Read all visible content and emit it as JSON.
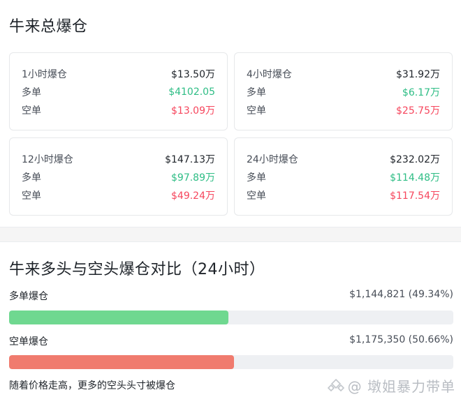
{
  "title": "牛来总爆仓",
  "cards": [
    {
      "period": "1小时爆仓",
      "total": "$13.50万",
      "long_label": "多单",
      "long": "$4102.05",
      "short_label": "空单",
      "short": "$13.09万"
    },
    {
      "period": "4小时爆仓",
      "total": "$31.92万",
      "long_label": "多单",
      "long": "$6.17万",
      "short_label": "空单",
      "short": "$25.75万"
    },
    {
      "period": "12小时爆仓",
      "total": "$147.13万",
      "long_label": "多单",
      "long": "$97.89万",
      "short_label": "空单",
      "short": "$49.24万"
    },
    {
      "period": "24小时爆仓",
      "total": "$232.02万",
      "long_label": "多单",
      "long": "$114.48万",
      "short_label": "空单",
      "short": "$117.54万"
    }
  ],
  "comparison": {
    "title": "牛来多头与空头爆仓对比（24小时）",
    "long": {
      "label": "多单爆仓",
      "value": "$1,144,821 (49.34%)",
      "ratio": 0.4934
    },
    "short": {
      "label": "空单爆仓",
      "value": "$1,175,350 (50.66%)",
      "ratio": 0.5066
    },
    "note": "随着价格走高，更多的空头头寸被爆仓"
  },
  "watermark": "@ 墩姐暴力带单",
  "colors": {
    "long": "#2ebd85",
    "short": "#f6465d",
    "long_bar": "#6fd890",
    "short_bar": "#f07b6e"
  }
}
